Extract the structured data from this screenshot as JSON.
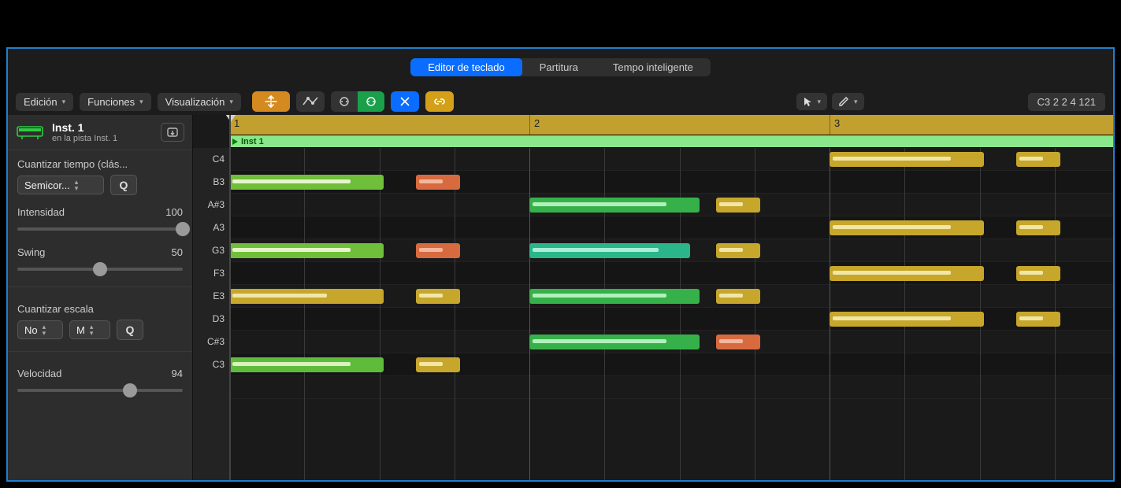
{
  "tabs": {
    "keyboard": "Editor de teclado",
    "score": "Partitura",
    "smart_tempo": "Tempo inteligente"
  },
  "toolbar": {
    "menus": {
      "edit": "Edición",
      "functions": "Funciones",
      "view": "Visualización"
    },
    "icons": {
      "collapse": "collapse-automation-icon",
      "automation": "automation-curve-icon",
      "mask1": "midi-in-icon",
      "mask2": "midi-out-icon",
      "snap": "snap-icon",
      "link": "link-icon",
      "pointer": "pointer-tool-icon",
      "pencil": "pencil-tool-icon"
    },
    "readout": "C3   2 2 4 121"
  },
  "track": {
    "name": "Inst. 1",
    "sub": "en la pista Inst. 1"
  },
  "side": {
    "quantize_time_label": "Cuantizar tiempo (clás...",
    "quantize_time_value": "Semicor...",
    "q_btn": "Q",
    "intensity_label": "Intensidad",
    "intensity_value": "100",
    "intensity_pct": 100,
    "swing_label": "Swing",
    "swing_value": "50",
    "swing_pct": 50,
    "scale_label": "Cuantizar escala",
    "scale_mode": "No",
    "scale_key": "M",
    "velocity_label": "Velocidad",
    "velocity_value": "94",
    "velocity_pct": 68
  },
  "note_labels": [
    "C4",
    "B3",
    "A#3",
    "A3",
    "G3",
    "F3",
    "E3",
    "D3",
    "C#3",
    "C3"
  ],
  "ruler_bars": [
    "1",
    "2",
    "3"
  ],
  "region_name": "Inst 1",
  "timeline": {
    "barWidth": 381,
    "beatWidth": 95.25
  },
  "notes": [
    {
      "row": 1,
      "start": 0,
      "len": 196,
      "color": "#6fbf3a",
      "bar": "#e6f4cc",
      "barLen": 150
    },
    {
      "row": 4,
      "start": 0,
      "len": 196,
      "color": "#6fbf3a",
      "bar": "#e6f4cc",
      "barLen": 150
    },
    {
      "row": 6,
      "start": 0,
      "len": 196,
      "color": "#c6a72c",
      "bar": "#f1e6a6",
      "barLen": 120
    },
    {
      "row": 9,
      "start": 0,
      "len": 196,
      "color": "#5fbb3a",
      "bar": "#d9f2bf",
      "barLen": 150
    },
    {
      "row": 1,
      "start": 237,
      "len": 56,
      "color": "#d86a40",
      "bar": "#f4b79e",
      "barLen": 30
    },
    {
      "row": 4,
      "start": 237,
      "len": 56,
      "color": "#d86a40",
      "bar": "#f4b79e",
      "barLen": 30
    },
    {
      "row": 6,
      "start": 237,
      "len": 56,
      "color": "#c6a72c",
      "bar": "#f1e6a6",
      "barLen": 30
    },
    {
      "row": 9,
      "start": 237,
      "len": 56,
      "color": "#c6a72c",
      "bar": "#f1e6a6",
      "barLen": 30
    },
    {
      "row": 2,
      "start": 381,
      "len": 216,
      "color": "#36b14a",
      "bar": "#b1f0bd",
      "barLen": 170
    },
    {
      "row": 4,
      "start": 381,
      "len": 204,
      "color": "#2bb58a",
      "bar": "#a9efd6",
      "barLen": 160
    },
    {
      "row": 6,
      "start": 381,
      "len": 216,
      "color": "#36b14a",
      "bar": "#b1f0bd",
      "barLen": 170
    },
    {
      "row": 8,
      "start": 381,
      "len": 216,
      "color": "#36b14a",
      "bar": "#b1f0bd",
      "barLen": 170
    },
    {
      "row": 2,
      "start": 618,
      "len": 56,
      "color": "#c6a72c",
      "bar": "#f1e6a6",
      "barLen": 30
    },
    {
      "row": 4,
      "start": 618,
      "len": 56,
      "color": "#c6a72c",
      "bar": "#f1e6a6",
      "barLen": 30
    },
    {
      "row": 6,
      "start": 618,
      "len": 56,
      "color": "#c6a72c",
      "bar": "#f1e6a6",
      "barLen": 30
    },
    {
      "row": 8,
      "start": 618,
      "len": 56,
      "color": "#d86a40",
      "bar": "#f4b79e",
      "barLen": 30
    },
    {
      "row": 0,
      "start": 762,
      "len": 196,
      "color": "#c6a72c",
      "bar": "#f1e6a6",
      "barLen": 150
    },
    {
      "row": 3,
      "start": 762,
      "len": 196,
      "color": "#c6a72c",
      "bar": "#f1e6a6",
      "barLen": 150
    },
    {
      "row": 5,
      "start": 762,
      "len": 196,
      "color": "#c6a72c",
      "bar": "#f1e6a6",
      "barLen": 150
    },
    {
      "row": 7,
      "start": 762,
      "len": 196,
      "color": "#c6a72c",
      "bar": "#f1e6a6",
      "barLen": 150
    },
    {
      "row": 0,
      "start": 999,
      "len": 56,
      "color": "#c6a72c",
      "bar": "#f1e6a6",
      "barLen": 30
    },
    {
      "row": 3,
      "start": 999,
      "len": 56,
      "color": "#c6a72c",
      "bar": "#f1e6a6",
      "barLen": 30
    },
    {
      "row": 5,
      "start": 999,
      "len": 56,
      "color": "#c6a72c",
      "bar": "#f1e6a6",
      "barLen": 30
    },
    {
      "row": 7,
      "start": 999,
      "len": 56,
      "color": "#c6a72c",
      "bar": "#f1e6a6",
      "barLen": 30
    }
  ]
}
